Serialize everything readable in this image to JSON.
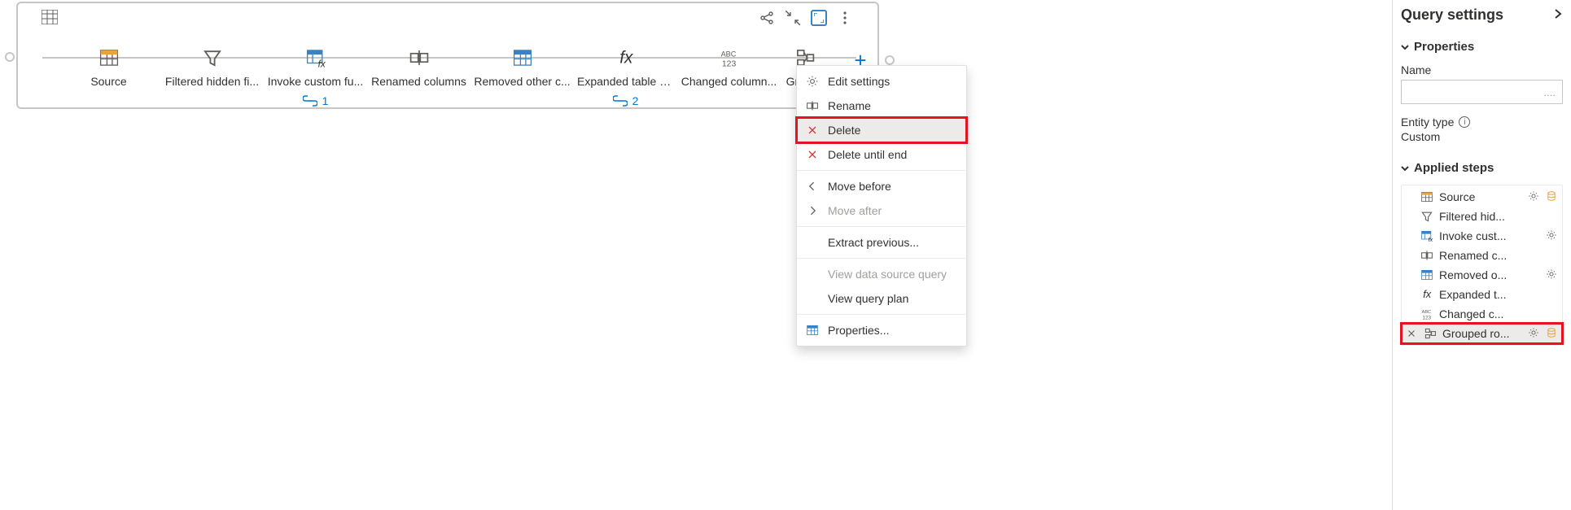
{
  "diagram": {
    "steps": [
      {
        "label": "Source",
        "icon": "table-orange",
        "link": null
      },
      {
        "label": "Filtered hidden fi...",
        "icon": "funnel",
        "link": null
      },
      {
        "label": "Invoke custom fu...",
        "icon": "table-fx",
        "link": "1"
      },
      {
        "label": "Renamed columns",
        "icon": "rename",
        "link": null
      },
      {
        "label": "Removed other c...",
        "icon": "table-blue",
        "link": null
      },
      {
        "label": "Expanded table c...",
        "icon": "fx",
        "link": "2"
      },
      {
        "label": "Changed column...",
        "icon": "abc123",
        "link": null
      },
      {
        "label": "Groupe",
        "icon": "group",
        "link": null
      }
    ]
  },
  "contextMenu": {
    "items": [
      {
        "label": "Edit settings",
        "icon": "gear",
        "kind": "normal"
      },
      {
        "label": "Rename",
        "icon": "rename",
        "kind": "normal"
      },
      {
        "label": "Delete",
        "icon": "x",
        "kind": "danger-highlight"
      },
      {
        "label": "Delete until end",
        "icon": "x",
        "kind": "danger"
      },
      {
        "label": "Move before",
        "icon": "chev-left",
        "kind": "normal"
      },
      {
        "label": "Move after",
        "icon": "chev-right",
        "kind": "disabled"
      },
      {
        "label": "Extract previous...",
        "icon": "",
        "kind": "normal"
      },
      {
        "label": "View data source query",
        "icon": "",
        "kind": "disabled"
      },
      {
        "label": "View query plan",
        "icon": "",
        "kind": "normal"
      },
      {
        "label": "Properties...",
        "icon": "table-blue",
        "kind": "normal"
      }
    ]
  },
  "pane": {
    "title": "Query settings",
    "properties_head": "Properties",
    "name_label": "Name",
    "name_value": "....",
    "entity_label": "Entity type",
    "entity_value": "Custom",
    "applied_head": "Applied steps",
    "steps": [
      {
        "label": "Source",
        "icon": "table-orange",
        "gear": true,
        "db": true,
        "selected": false
      },
      {
        "label": "Filtered hid...",
        "icon": "funnel",
        "gear": false,
        "db": false,
        "selected": false
      },
      {
        "label": "Invoke cust...",
        "icon": "table-fx",
        "gear": true,
        "db": false,
        "selected": false
      },
      {
        "label": "Renamed c...",
        "icon": "rename",
        "gear": false,
        "db": false,
        "selected": false
      },
      {
        "label": "Removed o...",
        "icon": "table-blue",
        "gear": true,
        "db": false,
        "selected": false
      },
      {
        "label": "Expanded t...",
        "icon": "fx",
        "gear": false,
        "db": false,
        "selected": false
      },
      {
        "label": "Changed c...",
        "icon": "abc123",
        "gear": false,
        "db": false,
        "selected": false
      },
      {
        "label": "Grouped ro...",
        "icon": "group",
        "gear": true,
        "db": true,
        "selected": true
      }
    ]
  }
}
